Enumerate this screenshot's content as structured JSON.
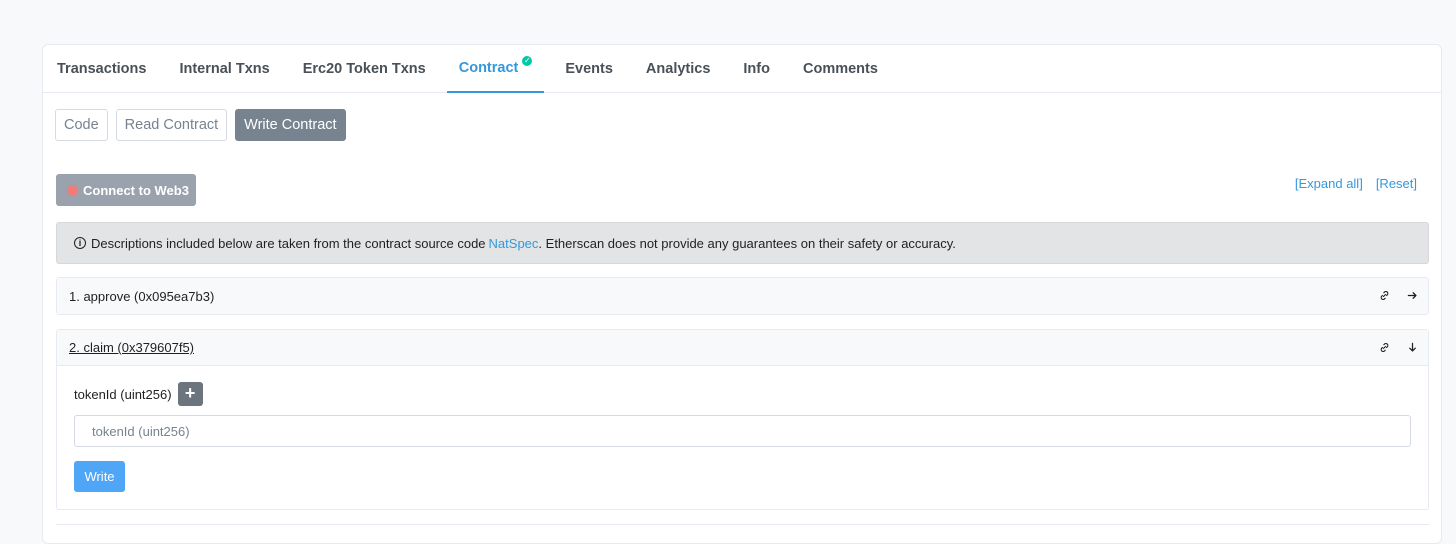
{
  "tabs": [
    {
      "label": "Transactions"
    },
    {
      "label": "Internal Txns"
    },
    {
      "label": "Erc20 Token Txns"
    },
    {
      "label": "Contract"
    },
    {
      "label": "Events"
    },
    {
      "label": "Analytics"
    },
    {
      "label": "Info"
    },
    {
      "label": "Comments"
    }
  ],
  "subtabs": [
    {
      "label": "Code"
    },
    {
      "label": "Read Contract"
    },
    {
      "label": "Write Contract"
    }
  ],
  "connect_button": {
    "label": "Connect to Web3"
  },
  "links": {
    "expand_all": "[Expand all]",
    "reset": "[Reset]"
  },
  "notice": {
    "before": "Descriptions included below are taken from the contract source code",
    "link": "NatSpec",
    "after": ". Etherscan does not provide any guarantees on their safety or accuracy."
  },
  "functions": [
    {
      "title": "1. approve (0x095ea7b3)"
    },
    {
      "title": "2. claim (0x379607f5)"
    }
  ],
  "claim": {
    "param_label": "tokenId (uint256)",
    "plus": "+",
    "input_placeholder": "tokenId (uint256)",
    "write_label": "Write"
  },
  "colors": {
    "accent": "#3498db",
    "verified": "#00c9a7",
    "write_button": "#4fa5f6"
  },
  "icons": {
    "link": "link-icon",
    "expand": "arrow-right-icon",
    "collapse": "arrow-down-icon",
    "info": "info-icon"
  }
}
